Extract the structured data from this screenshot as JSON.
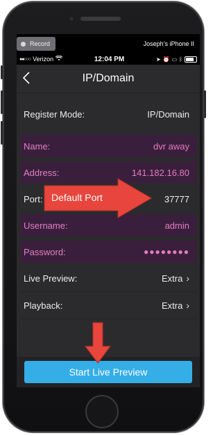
{
  "recording": {
    "label": "Record",
    "device": "Joseph’s iPhone II"
  },
  "status_bar": {
    "carrier": "Verizon",
    "time": "12:04 PM"
  },
  "nav": {
    "title": "IP/Domain"
  },
  "form": {
    "register_mode": {
      "label": "Register Mode:",
      "value": "IP/Domain"
    },
    "name": {
      "label": "Name:",
      "value": "dvr away"
    },
    "address": {
      "label": "Address:",
      "value": "141.182.16.80"
    },
    "port": {
      "label": "Port:",
      "value": "37777"
    },
    "username": {
      "label": "Username:",
      "value": "admin"
    },
    "password": {
      "label": "Password:",
      "value": "●●●●●●●●"
    },
    "live_preview": {
      "label": "Live Preview:",
      "value": "Extra"
    },
    "playback": {
      "label": "Playback:",
      "value": "Extra"
    }
  },
  "start_button": {
    "label": "Start Live Preview"
  },
  "annotation": {
    "text": "Default Port",
    "color": "#e8453c"
  },
  "colors": {
    "accent": "#35aee8",
    "highlight_bg": "#3a1f3d",
    "highlight_text": "#e27cc0"
  }
}
